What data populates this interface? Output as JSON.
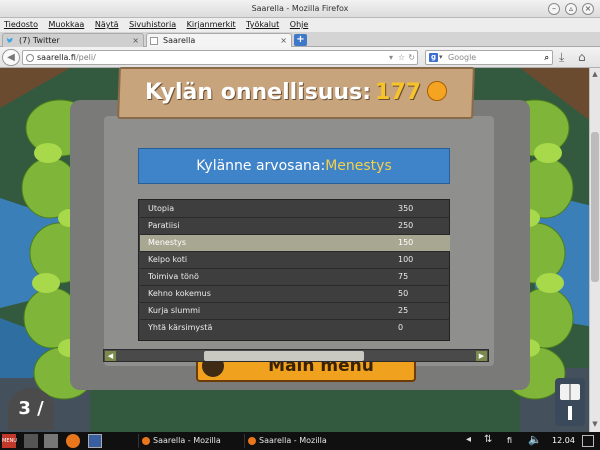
{
  "window": {
    "title": "Saarella - Mozilla Firefox"
  },
  "menu": [
    "Tiedosto",
    "Muokkaa",
    "Näytä",
    "Sivuhistoria",
    "Kirjanmerkit",
    "Työkalut",
    "Ohje"
  ],
  "tabs": [
    {
      "label": "(7) Twitter",
      "icon": "twitter-icon",
      "active": false
    },
    {
      "label": "Saarella",
      "icon": "page-icon",
      "active": true
    }
  ],
  "nav": {
    "url_host": "saarella.fi",
    "url_path": "/peli/",
    "search_placeholder": "Google"
  },
  "game": {
    "happiness_label": "Kylän onnellisuus:",
    "happiness_value": "177",
    "rating_label": "Kylänne arvosana:",
    "rating_value": "Menestys",
    "rows": [
      {
        "name": "Utopia",
        "points": "350"
      },
      {
        "name": "Paratiisi",
        "points": "250"
      },
      {
        "name": "Menestys",
        "points": "150",
        "selected": true
      },
      {
        "name": "Kelpo koti",
        "points": "100"
      },
      {
        "name": "Toimiva tönö",
        "points": "75"
      },
      {
        "name": "Kehno kokemus",
        "points": "50"
      },
      {
        "name": "Kurja slummi",
        "points": "25"
      },
      {
        "name": "Yhtä kärsimystä",
        "points": "0"
      }
    ],
    "main_menu_label": "Main menu",
    "left_badge_text": "3 /"
  },
  "taskbar": {
    "items": [
      "Saarella - Mozilla Fire...",
      "Saarella - Mozilla Fire..."
    ],
    "lang": "fi",
    "clock": "12.04"
  },
  "colors": {
    "title_blue": "#3f83c8",
    "highlight_yellow": "#f5d14a",
    "selected_row": "#a8a892",
    "button_orange": "#f0a21e"
  }
}
